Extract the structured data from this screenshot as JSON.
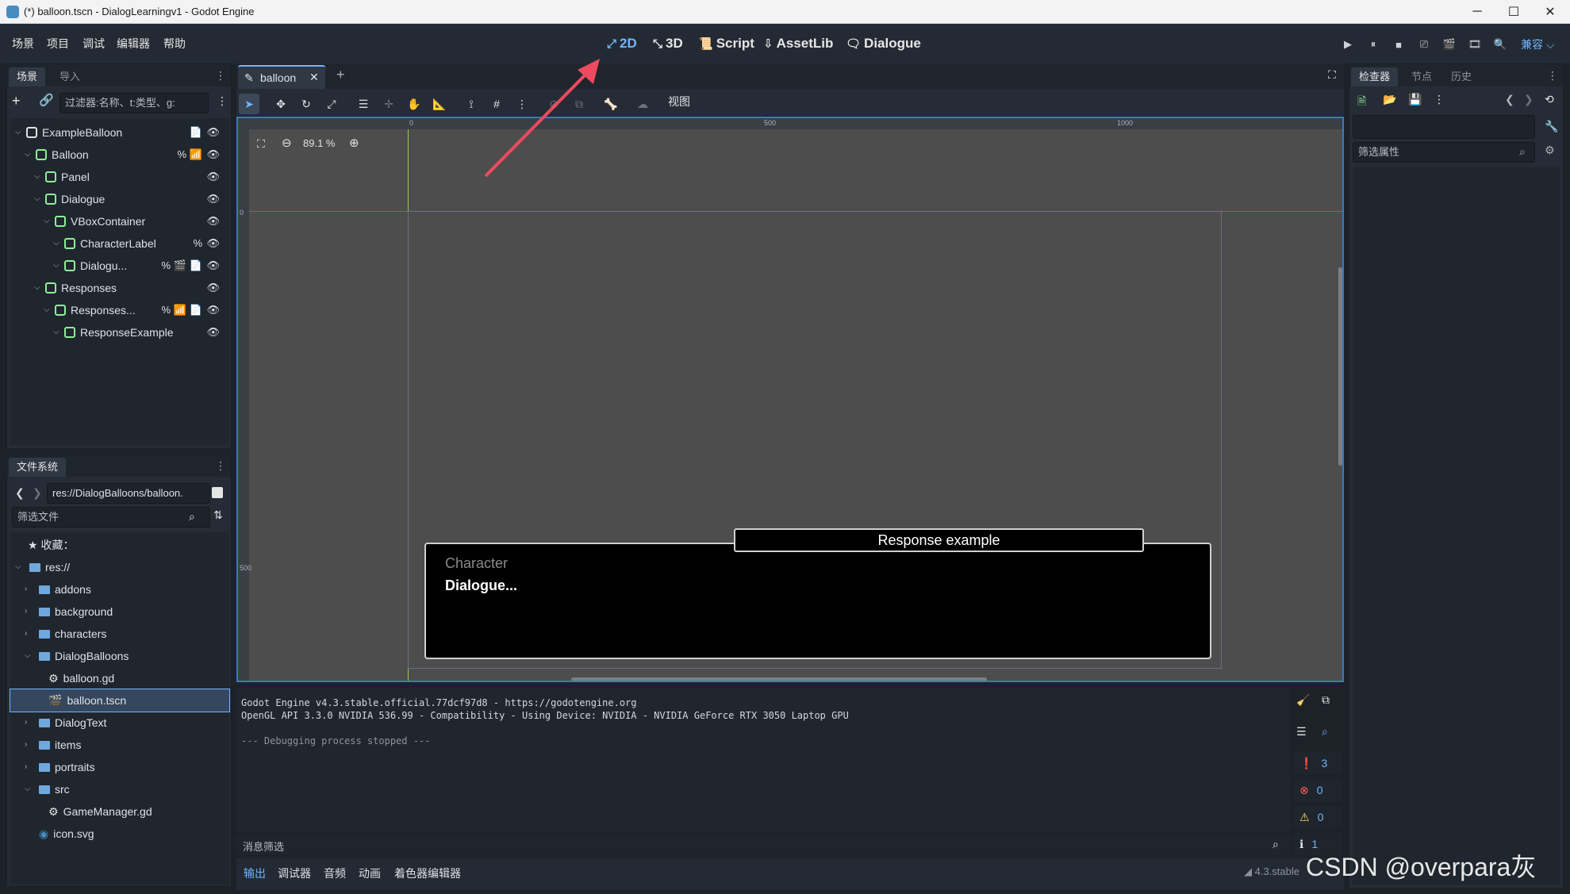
{
  "window": {
    "title": "(*) balloon.tscn - DialogLearningv1 - Godot Engine",
    "min_symbol": "─",
    "max_symbol": "☐",
    "close_symbol": "✕"
  },
  "menu": {
    "items": [
      "场景",
      "项目",
      "调试",
      "编辑器",
      "帮助"
    ]
  },
  "workspaces": [
    {
      "label": "2D",
      "icon": "2d-icon",
      "glyph": "⤢",
      "active": true
    },
    {
      "label": "3D",
      "icon": "3d-icon",
      "glyph": "⤡",
      "active": false
    },
    {
      "label": "Script",
      "icon": "script-icon",
      "glyph": "📜",
      "active": false
    },
    {
      "label": "AssetLib",
      "icon": "download-icon",
      "glyph": "⇩",
      "active": false
    },
    {
      "label": "Dialogue",
      "icon": "dialogue-icon",
      "glyph": "🗨",
      "active": false
    }
  ],
  "run_controls": {
    "renderer": "兼容 ⌵",
    "buttons": [
      "▶",
      "⏸",
      "■",
      "⎚",
      "🎬",
      "🎞",
      "🔍"
    ]
  },
  "scene_dock": {
    "tabs": [
      "场景",
      "导入"
    ],
    "filter_placeholder": "过滤器:名称、t:类型、g:",
    "nodes": [
      {
        "name": "ExampleBalloon",
        "depth": 0,
        "icon_color": "#e0e0e0",
        "extras": [
          "📄"
        ]
      },
      {
        "name": "Balloon",
        "depth": 1,
        "icon_color": "#8eef97",
        "extras": [
          "%",
          "📶"
        ]
      },
      {
        "name": "Panel",
        "depth": 2,
        "icon_color": "#8eef97",
        "extras": []
      },
      {
        "name": "Dialogue",
        "depth": 2,
        "icon_color": "#8eef97",
        "extras": []
      },
      {
        "name": "VBoxContainer",
        "depth": 3,
        "icon_color": "#8eef97",
        "extras": []
      },
      {
        "name": "CharacterLabel",
        "depth": 4,
        "icon_color": "#8eef97",
        "extras": [
          "%"
        ]
      },
      {
        "name": "Dialogu...",
        "depth": 4,
        "icon_color": "#8eef97",
        "extras": [
          "%",
          "🎬",
          "📄"
        ]
      },
      {
        "name": "Responses",
        "depth": 2,
        "icon_color": "#8eef97",
        "extras": []
      },
      {
        "name": "Responses...",
        "depth": 3,
        "icon_color": "#8eef97",
        "extras": [
          "%",
          "📶",
          "📄"
        ]
      },
      {
        "name": "ResponseExample",
        "depth": 4,
        "icon_color": "#8eef97",
        "extras": []
      }
    ]
  },
  "filesystem": {
    "tab": "文件系统",
    "path": "res://DialogBalloons/balloon.",
    "filter_placeholder": "筛选文件",
    "favorites": "收藏：",
    "items": [
      {
        "name": "res://",
        "depth": 0,
        "type": "folder",
        "open": true
      },
      {
        "name": "addons",
        "depth": 1,
        "type": "folder",
        "open": false
      },
      {
        "name": "background",
        "depth": 1,
        "type": "folder",
        "open": false
      },
      {
        "name": "characters",
        "depth": 1,
        "type": "folder",
        "open": false
      },
      {
        "name": "DialogBalloons",
        "depth": 1,
        "type": "folder",
        "open": true
      },
      {
        "name": "balloon.gd",
        "depth": 2,
        "type": "script",
        "open": false
      },
      {
        "name": "balloon.tscn",
        "depth": 2,
        "type": "scene",
        "open": false,
        "selected": true
      },
      {
        "name": "DialogText",
        "depth": 1,
        "type": "folder",
        "open": false
      },
      {
        "name": "items",
        "depth": 1,
        "type": "folder",
        "open": false
      },
      {
        "name": "portraits",
        "depth": 1,
        "type": "folder",
        "open": false
      },
      {
        "name": "src",
        "depth": 1,
        "type": "folder",
        "open": true
      },
      {
        "name": "GameManager.gd",
        "depth": 2,
        "type": "script",
        "open": false
      },
      {
        "name": "icon.svg",
        "depth": 1,
        "type": "image",
        "open": false
      }
    ]
  },
  "editor": {
    "tab_label": "balloon",
    "zoom": "89.1 %",
    "view_menu": "视图",
    "ruler_labels": [
      "0",
      "500",
      "1000"
    ],
    "ruler_left_labels": [
      "0",
      "500"
    ],
    "character_label": "Character",
    "dialogue_label": "Dialogue...",
    "response_label": "Response example"
  },
  "console": {
    "lines": [
      "Godot Engine v4.3.stable.official.77dcf97d8 - https://godotengine.org",
      "OpenGL API 3.3.0 NVIDIA 536.99 - Compatibility - Using Device: NVIDIA - NVIDIA GeForce RTX 3050 Laptop GPU",
      "",
      "--- Debugging process stopped ---"
    ],
    "filter_placeholder": "消息筛选",
    "counts": {
      "messages": "3",
      "errors": "0",
      "warnings": "0",
      "editor": "1"
    }
  },
  "bottom_tabs": [
    "输出",
    "调试器",
    "音频",
    "动画",
    "着色器编辑器"
  ],
  "version": "4.3.stable",
  "inspector": {
    "tabs": [
      "检查器",
      "节点",
      "历史"
    ],
    "filter_placeholder": "筛选属性"
  },
  "watermark": "CSDN @overpara灰",
  "colors": {
    "accent": "#6fb5ff",
    "arrow": "#ee4a5f"
  }
}
